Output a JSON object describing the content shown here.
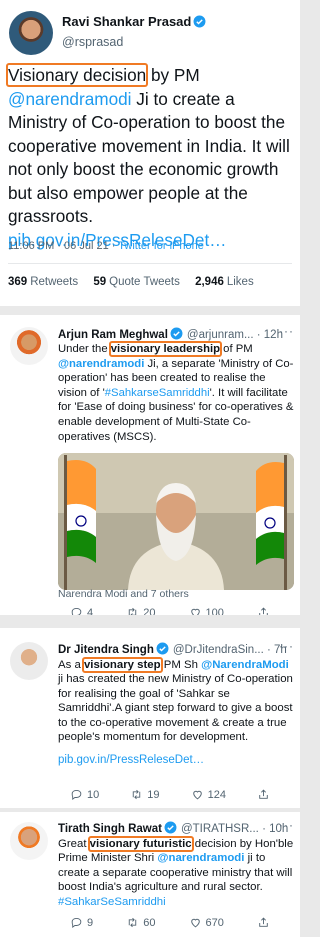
{
  "tweet_main": {
    "name": "Ravi Shankar Prasad",
    "handle": "@rsprasad",
    "highlight": "Visionary decision",
    "text_a": " by PM ",
    "mention": "@narendramodi",
    "text_b": " Ji to create a Ministry of Co-operation to boost the cooperative movement in India. It will not only boost the economic growth but also  empower people at the grassroots.",
    "link": "pib.gov.in/PressReleseDet…",
    "time": "11:06 PM · 06 Jul 21 · ",
    "source": "Twitter for iPhone",
    "retweets": "369",
    "retweets_label": "Retweets",
    "quotes": "59",
    "quotes_label": "Quote Tweets",
    "likes": "2,946",
    "likes_label": "Likes"
  },
  "tweet_2": {
    "name": "Arjun Ram Meghwal",
    "handle": "@arjunram...",
    "time": "· 12h",
    "more": "···",
    "t1": "Under the ",
    "hl": "visionary leadership",
    "t2": " of PM ",
    "mention": "@narendramodi",
    "t3": " Ji, a separate 'Ministry of Co-operation' has been created to realise the vision of '",
    "hashtag": "#SahkarseSamriddhi",
    "t4": "'. It will facilitate for 'Ease of doing business' for co-operatives & enable development of Multi-State Co-operatives (MSCS).",
    "tagged": "Narendra Modi and 7 others",
    "replies": "4",
    "retweets": "20",
    "likes": "100"
  },
  "tweet_3": {
    "name": "Dr Jitendra Singh",
    "handle": "@DrJitendraSin...",
    "time": "· 7h",
    "more": "···",
    "t1": "As a ",
    "hl": "visionary step",
    "t2": " PM Sh  ",
    "mention": "@NarendraModi",
    "t3": " ji has created the new Ministry of Co-operation for realising the goal of 'Sahkar se Samriddhi'.A giant step forward  to give a boost to the co-operative movement & create a true people's momentum for development.",
    "link": "pib.gov.in/PressReleseDet…",
    "replies": "10",
    "retweets": "19",
    "likes": "124"
  },
  "tweet_4": {
    "name": "Tirath Singh Rawat",
    "handle": "@TIRATHSR...",
    "time": "· 10h",
    "more": "···",
    "t1": "Great ",
    "hl": "visionary futuristic",
    "t2": " decision by Hon'ble Prime Minister Shri ",
    "mention": "@narendramodi",
    "t3": " ji to create a separate cooperative ministry that will boost India's agriculture and rural sector. ",
    "hashtag": "#SahkarSeSamriddhi",
    "replies": "9",
    "retweets": "60",
    "likes": "670"
  }
}
